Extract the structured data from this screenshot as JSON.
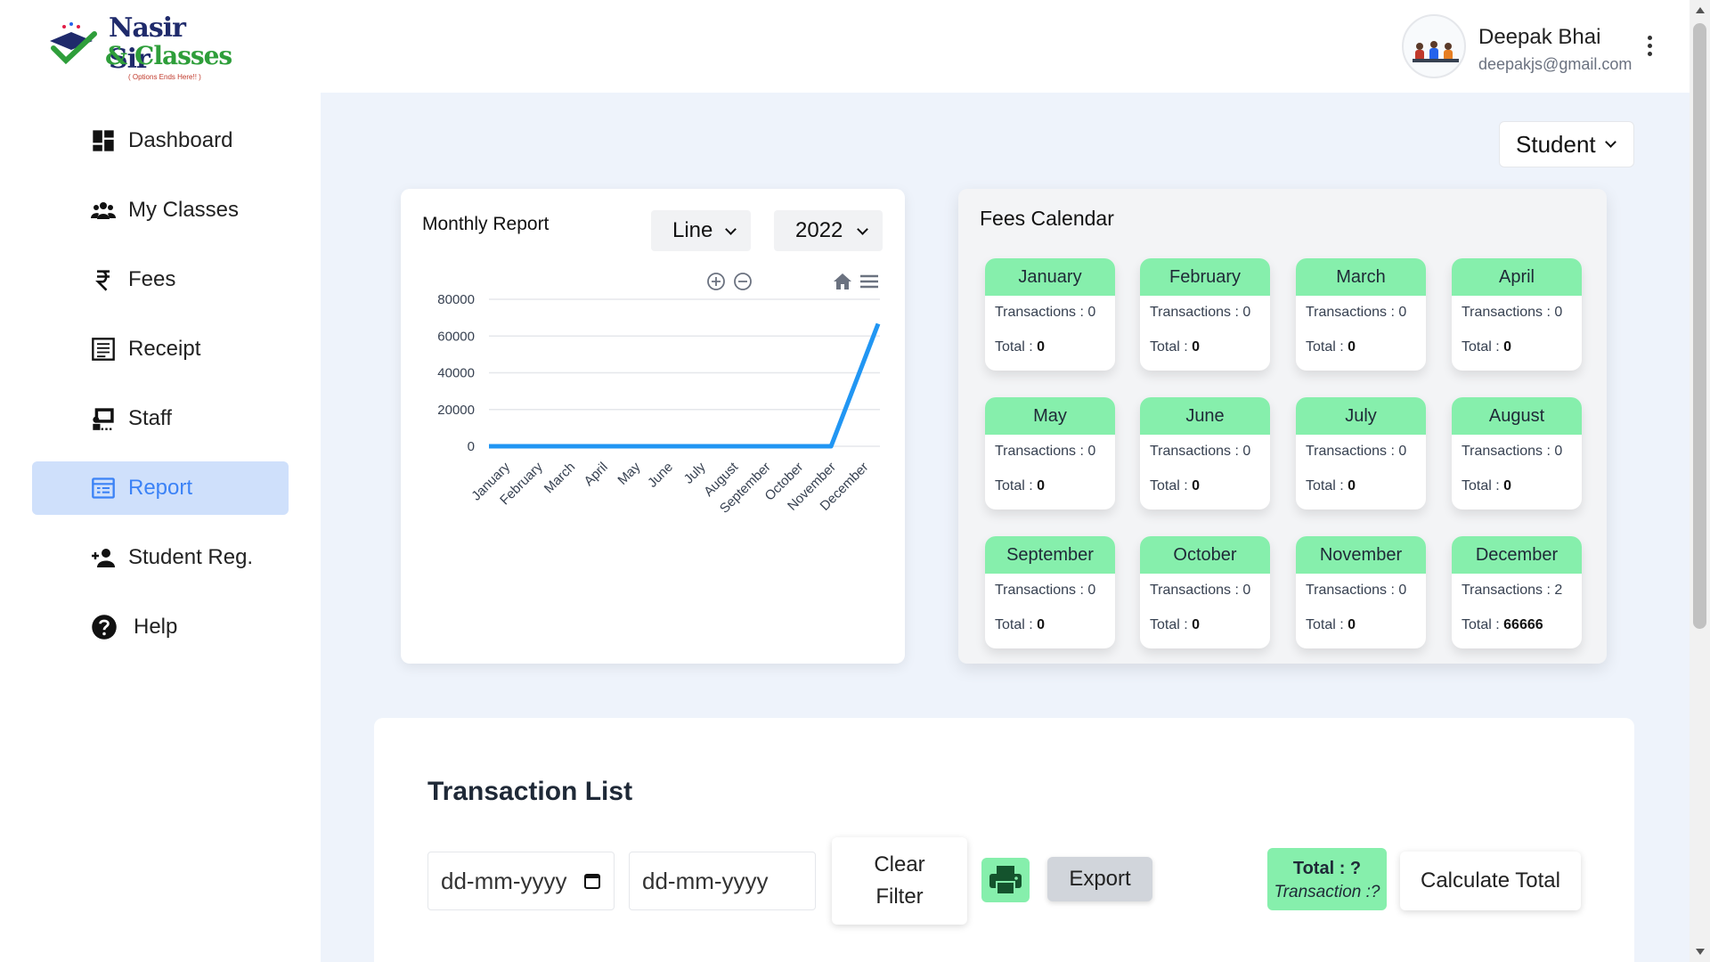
{
  "brand": {
    "line1": "Nasir Sir",
    "line2": "& Classes",
    "tagline": "( Options Ends Here!! )"
  },
  "sidebar": {
    "items": [
      {
        "label": "Dashboard",
        "icon": "dashboard-icon",
        "active": false
      },
      {
        "label": "My Classes",
        "icon": "users-icon",
        "active": false
      },
      {
        "label": "Fees",
        "icon": "rupee-icon",
        "active": false
      },
      {
        "label": "Receipt",
        "icon": "receipt-icon",
        "active": false
      },
      {
        "label": "Staff",
        "icon": "staff-icon",
        "active": false
      },
      {
        "label": "Report",
        "icon": "report-icon",
        "active": true
      },
      {
        "label": "Student Reg.",
        "icon": "add-user-icon",
        "active": false
      },
      {
        "label": "Help",
        "icon": "help-icon",
        "active": false
      }
    ]
  },
  "user": {
    "name": "Deepak Bhai",
    "email": "deepakjs@gmail.com"
  },
  "role_select": {
    "value": "Student"
  },
  "report": {
    "title": "Monthly Report",
    "type_select": "Line",
    "year_select": "2022"
  },
  "chart_data": {
    "type": "line",
    "categories": [
      "January",
      "February",
      "March",
      "April",
      "May",
      "June",
      "July",
      "August",
      "September",
      "October",
      "November",
      "December"
    ],
    "series": [
      {
        "values": [
          0,
          0,
          0,
          0,
          0,
          0,
          0,
          0,
          0,
          0,
          0,
          66666
        ]
      }
    ],
    "ylim": [
      0,
      80000
    ],
    "yticks": [
      0,
      20000,
      40000,
      60000,
      80000
    ],
    "grid": true,
    "color": "#2196f3"
  },
  "fees_calendar": {
    "title": "Fees Calendar",
    "tx_label": "Transactions : ",
    "total_label": "Total : ",
    "months": [
      {
        "name": "January",
        "transactions": "0",
        "total": "0"
      },
      {
        "name": "February",
        "transactions": "0",
        "total": "0"
      },
      {
        "name": "March",
        "transactions": "0",
        "total": "0"
      },
      {
        "name": "April",
        "transactions": "0",
        "total": "0"
      },
      {
        "name": "May",
        "transactions": "0",
        "total": "0"
      },
      {
        "name": "June",
        "transactions": "0",
        "total": "0"
      },
      {
        "name": "July",
        "transactions": "0",
        "total": "0"
      },
      {
        "name": "August",
        "transactions": "0",
        "total": "0"
      },
      {
        "name": "September",
        "transactions": "0",
        "total": "0"
      },
      {
        "name": "October",
        "transactions": "0",
        "total": "0"
      },
      {
        "name": "November",
        "transactions": "0",
        "total": "0"
      },
      {
        "name": "December",
        "transactions": "2",
        "total": "66666"
      }
    ]
  },
  "transactions": {
    "title": "Transaction List",
    "from_date_placeholder": "dd-mm-yyyy",
    "to_date_placeholder": "dd-mm-yyyy",
    "clear_filter_label": "Clear Filter",
    "export_label": "Export",
    "total_line1": "Total : ?",
    "total_line2": "Transaction :?",
    "calculate_label": "Calculate Total"
  }
}
